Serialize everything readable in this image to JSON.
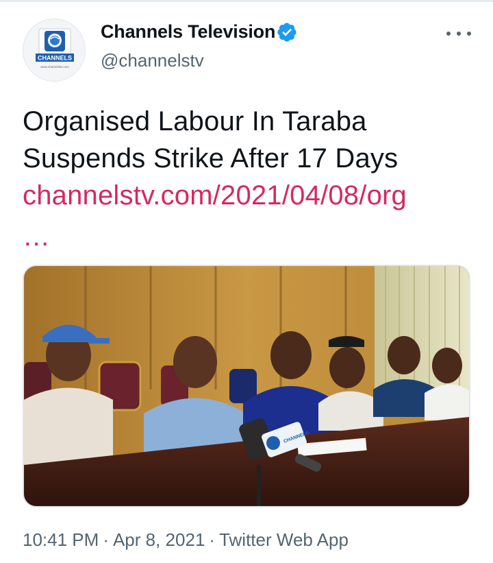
{
  "author": {
    "display_name": "Channels Television",
    "handle": "@channelstv",
    "verified": true,
    "avatar_text": "CHANNELS",
    "avatar_subtext": "www.channelstv.com"
  },
  "tweet": {
    "text_line_1": "Organised Labour In Taraba",
    "text_line_2": "Suspends Strike After 17 Days",
    "link": "channelstv.com/2021/04/08/org",
    "ellipsis": "…",
    "media_alt": "press conference photo",
    "mic_label": "CHANNELS"
  },
  "meta": {
    "time": "10:41 PM",
    "separator": "·",
    "date": "Apr 8, 2021",
    "source": "Twitter Web App"
  },
  "colors": {
    "link": "#d6285f",
    "verified": "#1d9bf0",
    "secondary_text": "#536471"
  },
  "icons": {
    "verified": "verified-badge-icon",
    "more": "more-horizontal-icon"
  }
}
